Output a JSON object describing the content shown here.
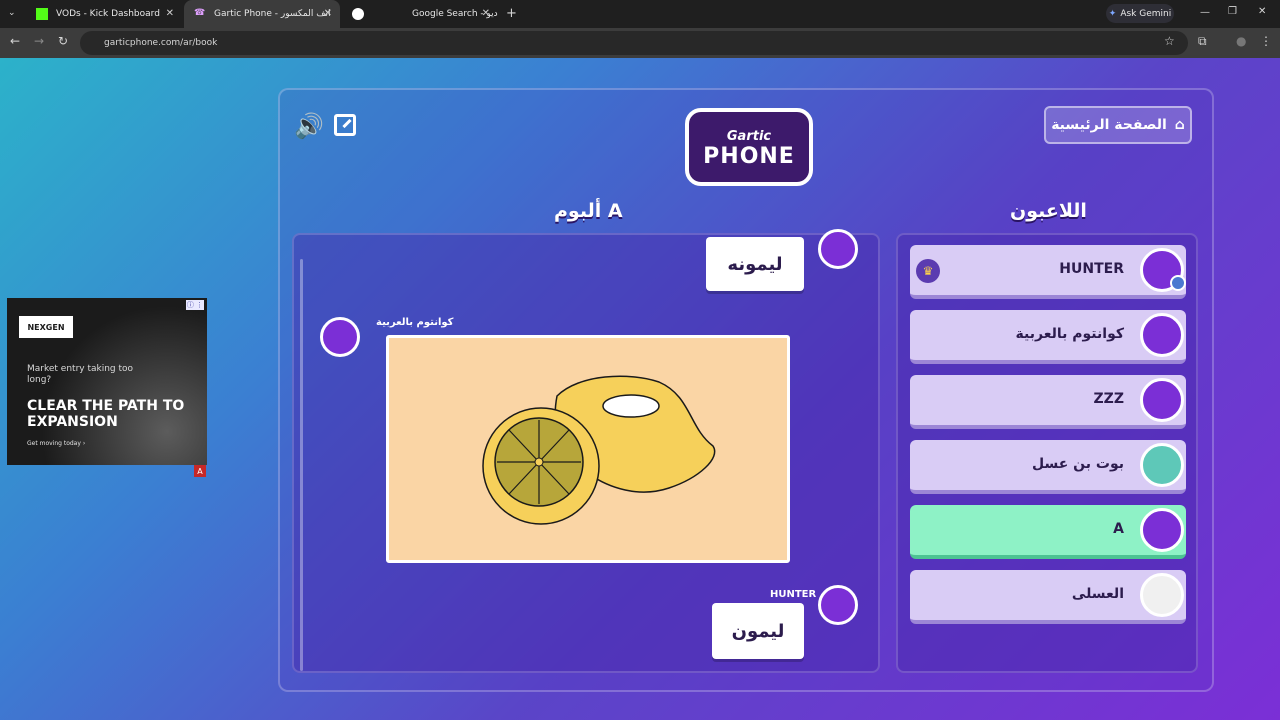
{
  "browser": {
    "tabs": [
      {
        "title": "VODs - Kick Dashboard"
      },
      {
        "title": "Gartic Phone - الهاتف المكسور"
      },
      {
        "title": "Google Search - ديو"
      }
    ],
    "new_tab": "+",
    "url": "garticphone.com/ar/book",
    "ask_gemini": "Ask Gemini"
  },
  "ad": {
    "brand": "NEXGEN",
    "subtitle": "Market entry taking too long?",
    "headline": "CLEAR THE PATH TO EXPANSION",
    "cta": "Get moving today ›"
  },
  "game": {
    "logo_top": "Gartic",
    "logo_bottom": "PHONE",
    "home_label": "الصفحة الرئيسية",
    "players_title": "اللاعبون",
    "album_title": "ألبوم A",
    "players": [
      {
        "name": "HUNTER",
        "host": true
      },
      {
        "name": "كوانتوم بالعربية"
      },
      {
        "name": "ZZZ"
      },
      {
        "name": "بوت بن عسل"
      },
      {
        "name": "A",
        "active": true
      },
      {
        "name": "العسلى"
      }
    ],
    "album": {
      "first_text": "ليمونه",
      "drawing_author": "كوانتوم بالعربية",
      "last_author": "HUNTER",
      "last_text": "ليمون"
    }
  },
  "colors": {
    "active_player": "#8ef2c6",
    "player_bg": "#d9ccf5",
    "drawing_bg": "#fad5a5"
  }
}
